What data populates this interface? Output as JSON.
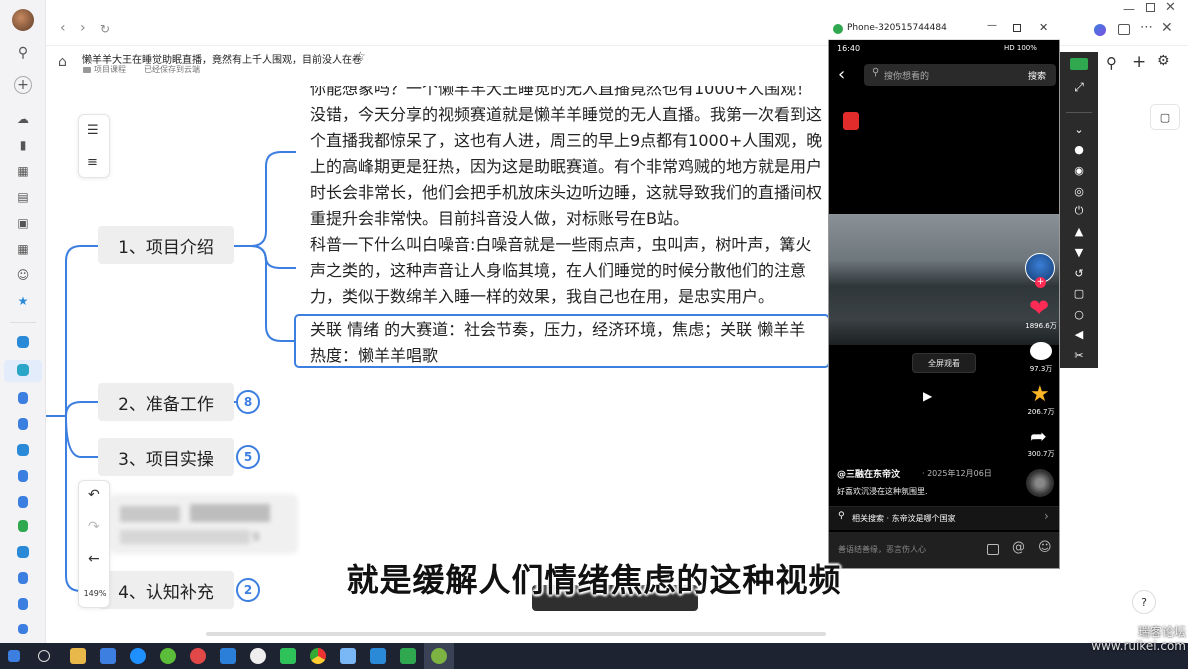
{
  "browser": {
    "doc_title": "懒羊羊大王在睡觉助眠直播，竟然有上千人围观，目前没人在卷",
    "folder": "项目课程",
    "save_status": "已经保存到云端"
  },
  "mindmap": {
    "branches": [
      {
        "label": "1、项目介绍"
      },
      {
        "label": "2、准备工作",
        "count": "8"
      },
      {
        "label": "3、项目实操",
        "count": "5"
      },
      {
        "label": "4、认知补充",
        "count": "2"
      }
    ],
    "paragraphs": [
      "你能想象吗？一个懒羊羊大王睡觉的无人直播竟然也有1000+人围观！没错，今天分享的视频赛道就是懒羊羊睡觉的无人直播。我第一次看到这个直播我都惊呆了，这也有人进，周三的早上9点都有1000+人围观，晚上的高峰期更是狂热，因为这是助眠赛道。有个非常鸡贼的地方就是用户时长会非常长，他们会把手机放床头边听边睡，这就导致我们的直播间权重提升会非常快。目前抖音没人做，对标账号在B站。",
      "科普一下什么叫白噪音:白噪音就是一些雨点声，虫叫声，树叶声，篝火声之类的，这种声音让人身临其境，在人们睡觉的时候分散他们的注意力，类似于数绵羊入睡一样的效果，我自己也在用，是忠实用户。",
      "关联 情绪 的大赛道：社会节奏，压力，经济环境，焦虑；关联 懒羊羊热度：懒羊羊唱歌"
    ],
    "zoom": "149%",
    "blurred_count": "9"
  },
  "phone": {
    "window_title": "Phone-320515744484",
    "status_time": "16:40",
    "status_right": "HD 100%",
    "search_placeholder": "搜你想看的",
    "search_button": "搜索",
    "fullscreen_label": "全屏观看",
    "likes": "1896.6万",
    "comments": "97.3万",
    "favorites": "206.7万",
    "shares": "300.7万",
    "author": "@三融在东帝汶",
    "date": "· 2025年12月06日",
    "caption": "好喜欢沉浸在这种氛围里.",
    "related_label": "相关搜索 · 东帝汶是哪个国家",
    "comment_placeholder": "善语结善缘，恶言伤人心"
  },
  "subtitle": "就是缓解人们情绪焦虑的这种视频",
  "watermark": "瑞客论坛 www.ruikei.com",
  "colors": {
    "accent": "#3d7fe0",
    "node_bg": "#eeeeee",
    "like": "#fe2c55",
    "star": "#fbb626"
  }
}
